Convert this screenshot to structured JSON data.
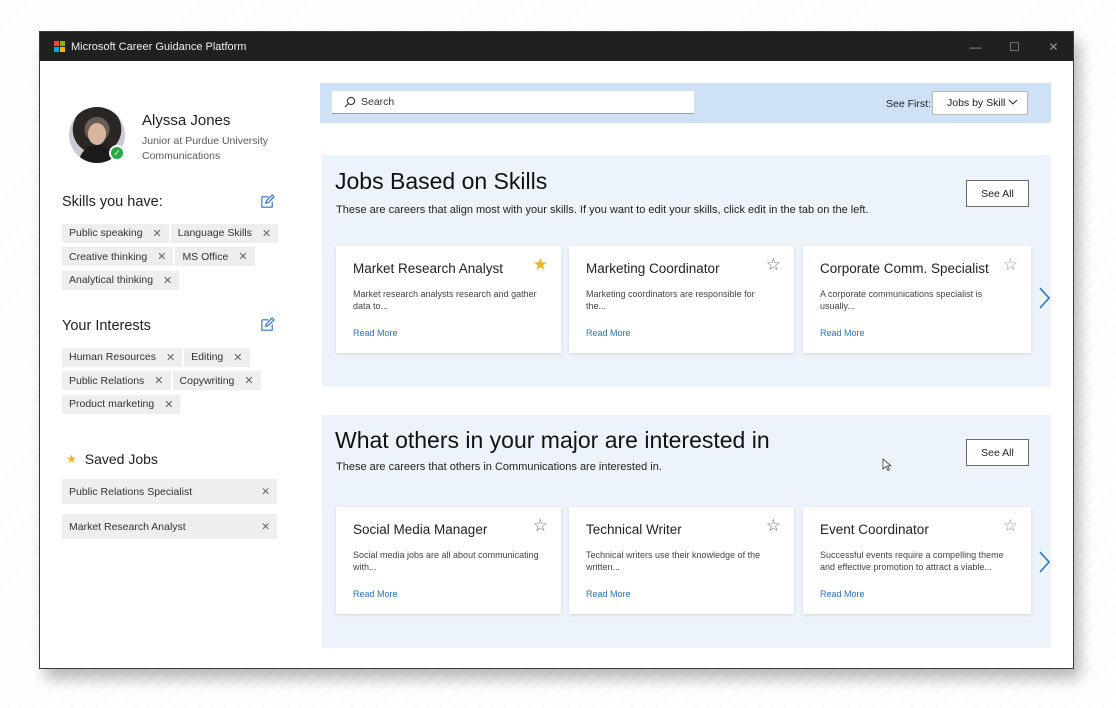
{
  "window": {
    "title": "Microsoft Career Guidance Platform",
    "controls": {
      "minimize": "—",
      "maximize": "☐",
      "close": "✕"
    }
  },
  "profile": {
    "name": "Alyssa Jones",
    "line1": "Junior at Purdue University",
    "line2": "Communications",
    "verified_icon": "checkmark-icon"
  },
  "skills": {
    "heading": "Skills you have:",
    "tags": [
      "Public speaking",
      "Language Skills",
      "Creative thinking",
      "MS Office",
      "Analytical thinking"
    ],
    "remove_glyph": "✕"
  },
  "interests": {
    "heading": "Your Interests",
    "tags": [
      "Human Resources",
      "Editing",
      "Public Relations",
      "Copywriting",
      "Product marketing"
    ]
  },
  "saved_jobs": {
    "heading": "Saved Jobs",
    "items": [
      "Public Relations Specialist",
      "Market Research Analyst"
    ]
  },
  "search": {
    "placeholder": "Search",
    "see_first_label": "See First:",
    "dropdown_value": "Jobs by Skill"
  },
  "skills_panel": {
    "title": "Jobs Based on Skills",
    "description": "These are careers that align most with your skills. If you want to edit your skills, click edit in the tab on the left.",
    "see_all": "See All",
    "cards": [
      {
        "title": "Market Research Analyst",
        "desc": "Market research analysts research and gather data to...",
        "link": "Read More",
        "starred": true
      },
      {
        "title": "Marketing Coordinator",
        "desc": "Marketing coordinators are responsible for the...",
        "link": "Read More",
        "starred": false
      },
      {
        "title": "Corporate Comm. Specialist",
        "desc": "A corporate communications specialist is usually...",
        "link": "Read More",
        "starred": false
      }
    ]
  },
  "major_panel": {
    "title": "What others in your major are interested in",
    "description": "These are careers that others in Communications are interested in.",
    "see_all": "See All",
    "cards": [
      {
        "title": "Social Media Manager",
        "desc": "Social media jobs are all about communicating with...",
        "link": "Read More",
        "starred": false
      },
      {
        "title": "Technical Writer",
        "desc": "Technical writers use their knowledge of the written...",
        "link": "Read More",
        "starred": false
      },
      {
        "title": "Event Coordinator",
        "desc": "Successful events require a compelling theme and effective promotion to attract a viable...",
        "link": "Read More",
        "starred": false
      }
    ]
  },
  "glyphs": {
    "star_filled": "★",
    "star_empty": "☆"
  },
  "colors": {
    "accent": "#2b72c2",
    "star": "#f0b323",
    "band": "#cfe1f4",
    "panel": "#edf3fa",
    "verified": "#27a844"
  }
}
